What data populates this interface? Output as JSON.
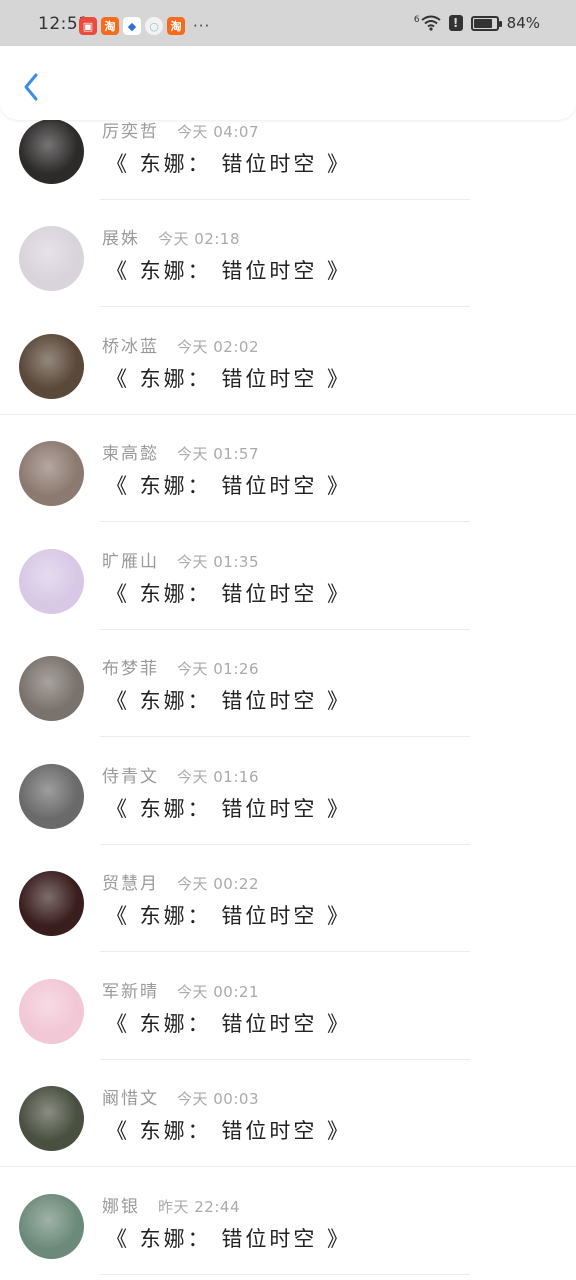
{
  "status_bar": {
    "time": "12:51",
    "more": "···",
    "network": "6",
    "battery_percent": "84%",
    "battery_level": 0.84,
    "app_icons": [
      "bank-app-icon",
      "taobao-icon",
      "shield-app-icon",
      "browser-icon",
      "taobao-icon"
    ]
  },
  "header": {
    "back_icon": "chevron-left-icon",
    "accent": "#3a8ee6"
  },
  "conversations": [
    {
      "name": "厉奕哲",
      "time": "今天 04:07",
      "message": "《 东娜： 错位时空 》",
      "avatar": "#2d2a2a"
    },
    {
      "name": "展姝",
      "time": "今天 02:18",
      "message": "《 东娜： 错位时空 》",
      "avatar": "#d9d3dc"
    },
    {
      "name": "桥冰蓝",
      "time": "今天 02:02",
      "message": "《 东娜： 错位时空 》",
      "avatar": "#5a4838"
    },
    {
      "name": "柬高懿",
      "time": "今天 01:57",
      "message": "《 东娜： 错位时空 》",
      "avatar": "#8c7a70"
    },
    {
      "name": "旷雁山",
      "time": "今天 01:35",
      "message": "《 东娜： 错位时空 》",
      "avatar": "#d8c8e6"
    },
    {
      "name": "布梦菲",
      "time": "今天 01:26",
      "message": "《 东娜： 错位时空 》",
      "avatar": "#7a726c"
    },
    {
      "name": "侍青文",
      "time": "今天 01:16",
      "message": "《 东娜： 错位时空 》",
      "avatar": "#6a6a6a"
    },
    {
      "name": "贸慧月",
      "time": "今天 00:22",
      "message": "《 东娜： 错位时空 》",
      "avatar": "#3a1e1e"
    },
    {
      "name": "军新晴",
      "time": "今天 00:21",
      "message": "《 东娜： 错位时空 》",
      "avatar": "#f2c7d6"
    },
    {
      "name": "阚惜文",
      "time": "今天 00:03",
      "message": "《 东娜： 错位时空 》",
      "avatar": "#4a5040"
    },
    {
      "name": "娜银",
      "time": "昨天 22:44",
      "message": "《 东娜： 错位时空 》",
      "avatar": "#6c8a7a"
    }
  ]
}
